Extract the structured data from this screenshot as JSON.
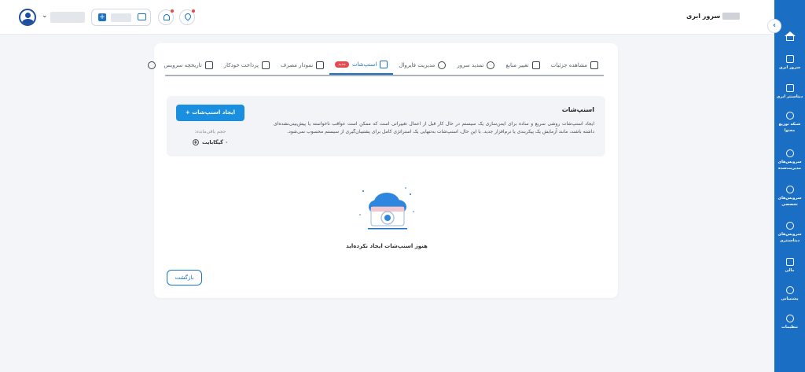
{
  "header": {
    "page_title": "سرور ابری",
    "wallet_plus": "+"
  },
  "sidebar": {
    "collapse_arrow": "‹",
    "items": [
      {
        "label": "سرور ابری",
        "icon": "server-icon"
      },
      {
        "label": "دیتاسنتر ابری",
        "icon": "database-icon"
      },
      {
        "label": "شبکه توزیع محتوا",
        "icon": "cdn-icon"
      },
      {
        "label": "سرویس‌های مدیریت‌شده",
        "icon": "managed-icon"
      },
      {
        "label": "سرویس‌های تخصصی",
        "icon": "special-icon"
      },
      {
        "label": "سرویس‌های دیتاسنتری",
        "icon": "datacenter-icon"
      },
      {
        "label": "مالی",
        "icon": "finance-icon"
      },
      {
        "label": "پشتیبانی",
        "icon": "support-icon"
      },
      {
        "label": "تنظیمات",
        "icon": "settings-icon"
      }
    ]
  },
  "tabs": [
    {
      "label": "مشاهده جزئیات",
      "icon": "details-icon"
    },
    {
      "label": "تغییر منابع",
      "icon": "resources-icon"
    },
    {
      "label": "تمدید سرور",
      "icon": "renew-icon"
    },
    {
      "label": "مدیریت فایروال",
      "icon": "firewall-icon"
    },
    {
      "label": "اسنپ‌شات",
      "icon": "snapshot-icon",
      "badge": "جدید",
      "active": true
    },
    {
      "label": "نمودار مصرف",
      "icon": "chart-icon"
    },
    {
      "label": "پرداخت خودکار",
      "icon": "autopay-icon"
    },
    {
      "label": "تاریخچه سرویس",
      "icon": "history-icon"
    },
    {
      "label": "",
      "icon": "refresh-icon"
    }
  ],
  "snapshot": {
    "title": "اسنپ‌شات",
    "description": "ایجاد اسنپ‌شات روشی سریع و ساده برای ایمن‌سازی یک سیستم در حال کار قبل از اعمال تغییراتی است که ممکن است عواقب ناخواسته یا پیش‌بینی‌نشده‌ای داشته باشند، مانند آزمایش یک پیکربندی یا نرم‌افزار جدید. با این حال، اسنپ‌شات به‌تنهایی یک استراتژی کامل برای پشتیبان‌گیری از سیستم محسوب نمی‌شود.",
    "create_button": "ایجاد اسنپ‌شات",
    "create_plus": "+",
    "remaining_label": "حجم باقی‌مانده:",
    "remaining_value": "۰ گیگابایت",
    "remaining_plus": "+",
    "empty_text": "هنوز اسنپ‌شات ایجاد نکرده‌اید"
  },
  "footer": {
    "back_button": "بازگشت"
  },
  "colors": {
    "primary": "#1a73c7",
    "sidebar": "#1a6fc4",
    "badge": "#e5484d"
  }
}
